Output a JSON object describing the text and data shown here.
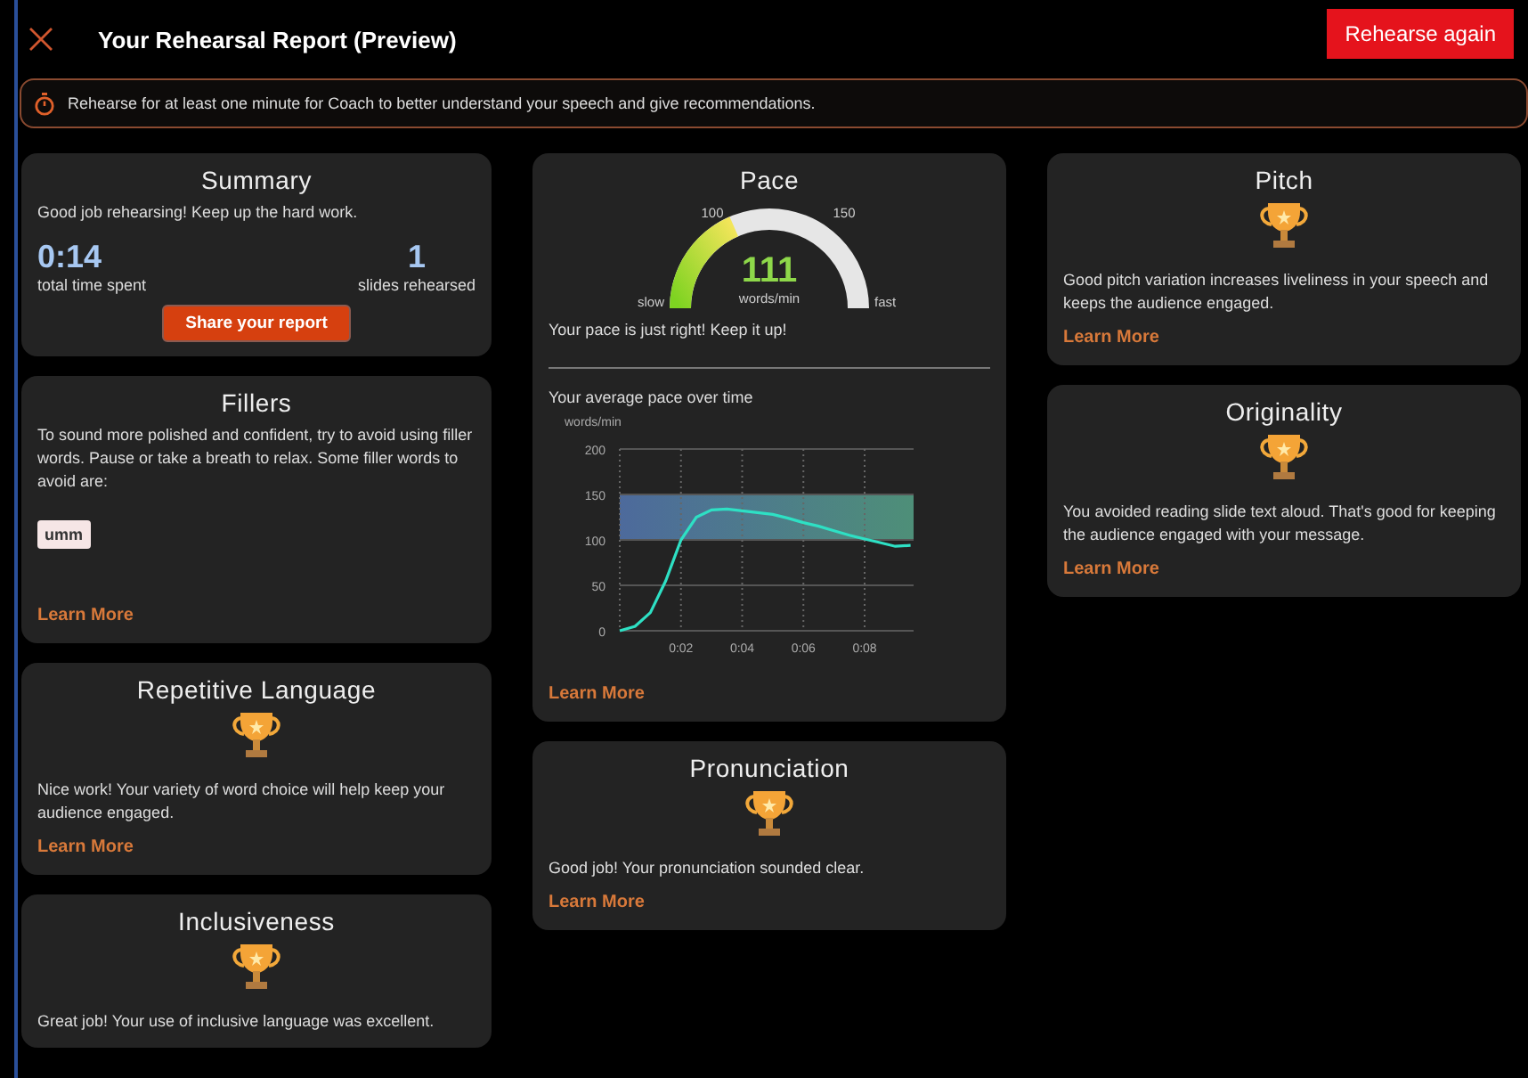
{
  "window": {
    "title": "Your Rehearsal Report (Preview)"
  },
  "actions": {
    "rehearse_again": "Rehearse again"
  },
  "notice": "Rehearse for at least one minute for Coach to better understand your speech and give recommendations.",
  "columns": [
    [
      {
        "kind": "summary",
        "title": "Summary",
        "message": "Good job rehearsing! Keep up the hard work.",
        "stats": [
          {
            "value": "0:14",
            "label": "total time spent"
          },
          {
            "value": "1",
            "label": "slides rehearsed"
          }
        ],
        "button": "Share your report"
      },
      {
        "kind": "fillers",
        "title": "Fillers",
        "message": "To sound more polished and confident, try to avoid using filler words. Pause or take a breath to relax. Some filler words to avoid are:",
        "words": [
          "umm"
        ],
        "link": "Learn More"
      },
      {
        "kind": "achievement",
        "title": "Repetitive Language",
        "message": "Nice work! Your variety of word choice will help keep your audience engaged.",
        "link": "Learn More"
      },
      {
        "kind": "achievement",
        "title": "Inclusiveness",
        "message": "Great job! Your use of inclusive language was excellent."
      }
    ],
    [
      {
        "kind": "pace",
        "title": "Pace",
        "gauge": {
          "value": "111",
          "unit": "words/min",
          "marks": [
            "100",
            "150"
          ],
          "min_label": "slow",
          "max_label": "fast"
        },
        "message": "Your pace is just right! Keep it up!",
        "chart_title": "Your average pace over time",
        "chart_data": {
          "type": "line",
          "ylabel": "words/min",
          "x": [
            0,
            0.5,
            1,
            1.5,
            2,
            2.5,
            3,
            3.5,
            4,
            4.5,
            5,
            5.5,
            6,
            6.5,
            7,
            7.5,
            8,
            8.5,
            9,
            9.5
          ],
          "series": [
            {
              "color": "#2ee0c4",
              "values": [
                0,
                5,
                20,
                55,
                100,
                125,
                133,
                134,
                132,
                130,
                128,
                124,
                119,
                115,
                110,
                105,
                101,
                97,
                93,
                94
              ]
            }
          ],
          "xlim": [
            0,
            9.6
          ],
          "ylim": [
            0,
            200
          ],
          "xticks": [
            {
              "value": 2,
              "label": "0:02"
            },
            {
              "value": 4,
              "label": "0:04"
            },
            {
              "value": 6,
              "label": "0:06"
            },
            {
              "value": 8,
              "label": "0:08"
            }
          ],
          "yticks": [
            0,
            50,
            100,
            150,
            200
          ],
          "grid": true,
          "bands": [
            {
              "axis": "y",
              "from": 100,
              "to": 150
            }
          ]
        },
        "link": "Learn More"
      },
      {
        "kind": "achievement",
        "title": "Pronunciation",
        "message": "Good job! Your pronunciation sounded clear.",
        "link": "Learn More"
      }
    ],
    [
      {
        "kind": "achievement",
        "title": "Pitch",
        "message": "Good pitch variation increases liveliness in your speech and keeps the audience engaged.",
        "link": "Learn More"
      },
      {
        "kind": "achievement",
        "title": "Originality",
        "message": "You avoided reading slide text aloud. That's good for keeping the audience engaged with your message.",
        "link": "Learn More"
      }
    ]
  ]
}
